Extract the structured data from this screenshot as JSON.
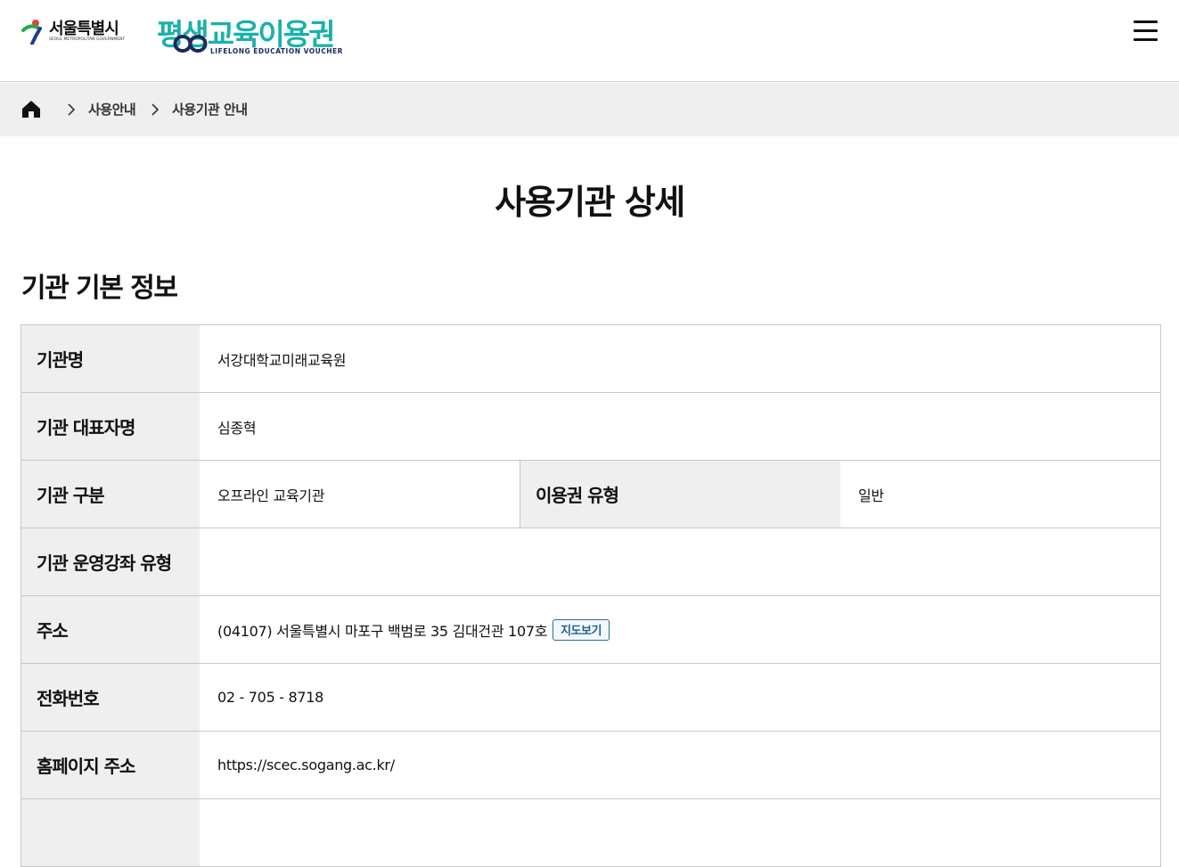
{
  "header": {
    "seoul_logo_name": "서울특별시",
    "seoul_logo_sub": "SEOUL METROPOLITAN GOVERNMENT",
    "voucher_title": "평생교육이용권",
    "voucher_sub": "LIFELONG EDUCATION VOUCHER",
    "menu_icon": "hamburger-menu-icon"
  },
  "breadcrumb": {
    "home_icon": "home-icon",
    "items": [
      "사용안내",
      "사용기관 안내"
    ]
  },
  "page": {
    "title": "사용기관 상세",
    "section_title": "기관 기본 정보"
  },
  "info": {
    "name_label": "기관명",
    "name_value": "서강대학교미래교육원",
    "rep_label": "기관 대표자명",
    "rep_value": "심종혁",
    "type_label": "기관 구분",
    "type_value": "오프라인 교육기관",
    "voucher_type_label": "이용권 유형",
    "voucher_type_value": "일반",
    "course_type_label": "기관 운영강좌 유형",
    "course_type_value": "",
    "address_label": "주소",
    "address_value": "(04107) 서울특별시 마포구 백범로 35 김대건관 107호",
    "map_button": "지도보기",
    "phone_label": "전화번호",
    "phone_value": "02 - 705 - 8718",
    "homepage_label": "홈페이지 주소",
    "homepage_value": "https://scec.sogang.ac.kr/"
  },
  "colors": {
    "accent_teal": "#1ab1ac",
    "navy": "#1b2a5c",
    "header_bg": "#efefef",
    "map_button_border": "#2b6a9c"
  }
}
